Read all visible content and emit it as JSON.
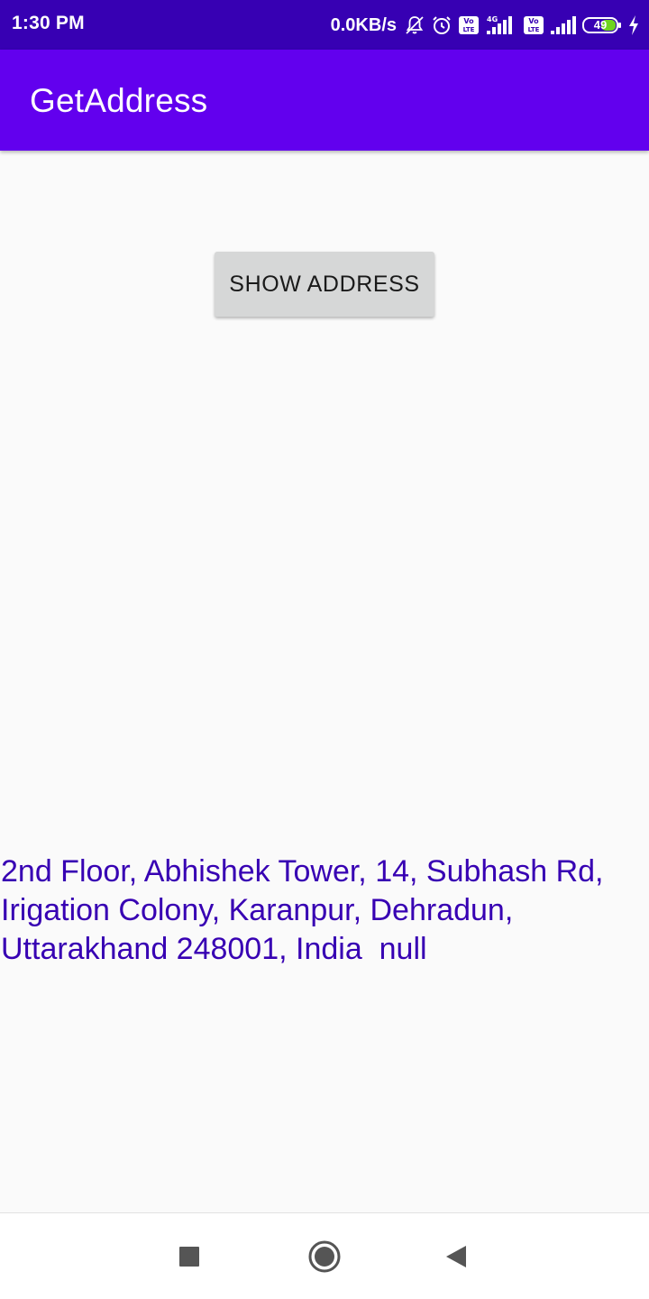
{
  "status_bar": {
    "time": "1:30 PM",
    "net_speed": "0.0KB/s",
    "battery_level": "49",
    "icons": [
      "notifications-off-icon",
      "alarm-icon",
      "volte-icon",
      "signal-4g-icon",
      "volte-icon",
      "signal-icon",
      "battery-icon",
      "charging-icon"
    ],
    "background_color": "#3700b3"
  },
  "app_bar": {
    "title": "GetAddress",
    "background_color": "#6200ee"
  },
  "main": {
    "show_address_button": "SHOW ADDRESS",
    "address_text": "2nd Floor, Abhishek Tower, 14, Subhash Rd, Irigation Colony, Karanpur, Dehradun, Uttarakhand 248001, India  null",
    "address_color": "#3700b3"
  },
  "nav_bar": {
    "buttons": [
      "recents-square-icon",
      "home-circle-icon",
      "back-triangle-icon"
    ]
  }
}
